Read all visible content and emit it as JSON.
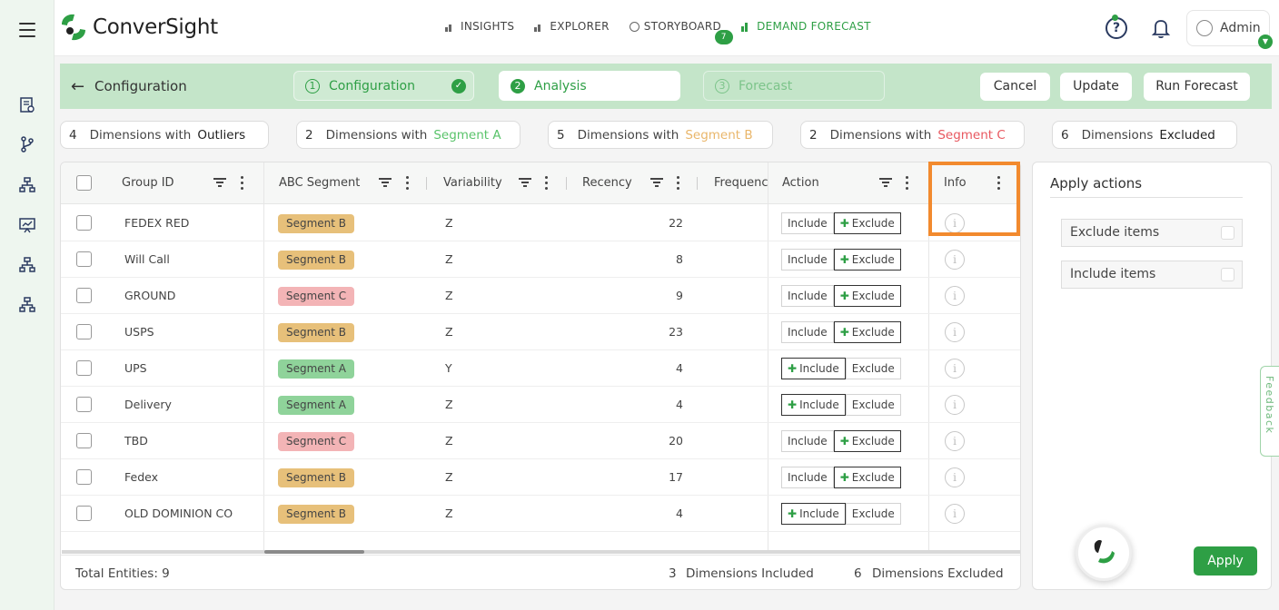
{
  "app": {
    "name": "ConverSight"
  },
  "nav": {
    "items": [
      {
        "label": "INSIGHTS",
        "active": false
      },
      {
        "label": "EXPLORER",
        "active": false
      },
      {
        "label": "STORYBOARD",
        "active": false,
        "badge": "7"
      },
      {
        "label": "DEMAND FORECAST",
        "active": true
      }
    ]
  },
  "user": {
    "name": "Admin"
  },
  "config": {
    "title": "Configuration",
    "steps": [
      {
        "num": "1",
        "label": "Configuration",
        "state": "done"
      },
      {
        "num": "2",
        "label": "Analysis",
        "state": "active"
      },
      {
        "num": "3",
        "label": "Forecast",
        "state": "pending"
      }
    ],
    "buttons": {
      "cancel": "Cancel",
      "update": "Update",
      "run": "Run Forecast"
    }
  },
  "summary": [
    {
      "count": "4",
      "text": "Dimensions with",
      "key": "Outliers",
      "color": "#222222"
    },
    {
      "count": "2",
      "text": "Dimensions with",
      "key": "Segment A",
      "color": "#59c36a"
    },
    {
      "count": "5",
      "text": "Dimensions with",
      "key": "Segment B",
      "color": "#e9b66a"
    },
    {
      "count": "2",
      "text": "Dimensions with",
      "key": "Segment C",
      "color": "#e8575f"
    },
    {
      "count": "6",
      "text": "Dimensions",
      "key": "Excluded",
      "color": "#222222"
    }
  ],
  "table": {
    "columns": {
      "group_id": "Group ID",
      "abc_segment": "ABC Segment",
      "variability": "Variability",
      "recency": "Recency",
      "frequency": "Frequenc",
      "action": "Action",
      "info": "Info"
    },
    "include_label": "Include",
    "exclude_label": "Exclude",
    "rows": [
      {
        "group_id": "FEDEX RED",
        "segment": "Segment B",
        "seg_class": "b",
        "variability": "Z",
        "recency": "22",
        "selected": "exclude"
      },
      {
        "group_id": "Will Call",
        "segment": "Segment B",
        "seg_class": "b",
        "variability": "Z",
        "recency": "8",
        "selected": "exclude"
      },
      {
        "group_id": "GROUND",
        "segment": "Segment C",
        "seg_class": "c",
        "variability": "Z",
        "recency": "9",
        "selected": "exclude"
      },
      {
        "group_id": "USPS",
        "segment": "Segment B",
        "seg_class": "b",
        "variability": "Z",
        "recency": "23",
        "selected": "exclude"
      },
      {
        "group_id": "UPS",
        "segment": "Segment A",
        "seg_class": "a",
        "variability": "Y",
        "recency": "4",
        "selected": "include"
      },
      {
        "group_id": "Delivery",
        "segment": "Segment A",
        "seg_class": "a",
        "variability": "Z",
        "recency": "4",
        "selected": "include"
      },
      {
        "group_id": "TBD",
        "segment": "Segment C",
        "seg_class": "c",
        "variability": "Z",
        "recency": "20",
        "selected": "exclude"
      },
      {
        "group_id": "Fedex",
        "segment": "Segment B",
        "seg_class": "b",
        "variability": "Z",
        "recency": "17",
        "selected": "exclude"
      },
      {
        "group_id": "OLD DOMINION CO",
        "segment": "Segment B",
        "seg_class": "b",
        "variability": "Z",
        "recency": "4",
        "selected": "include"
      }
    ],
    "footer": {
      "total": "Total Entities: 9",
      "included_count": "3",
      "included_text": "Dimensions Included",
      "excluded_count": "6",
      "excluded_text": "Dimensions Excluded"
    }
  },
  "actions_panel": {
    "title": "Apply actions",
    "options": [
      "Exclude items",
      "Include items"
    ],
    "apply": "Apply"
  },
  "feedback": "Feedback",
  "colors": {
    "brand": "#2e9f45",
    "highlight": "#f28a2e"
  }
}
